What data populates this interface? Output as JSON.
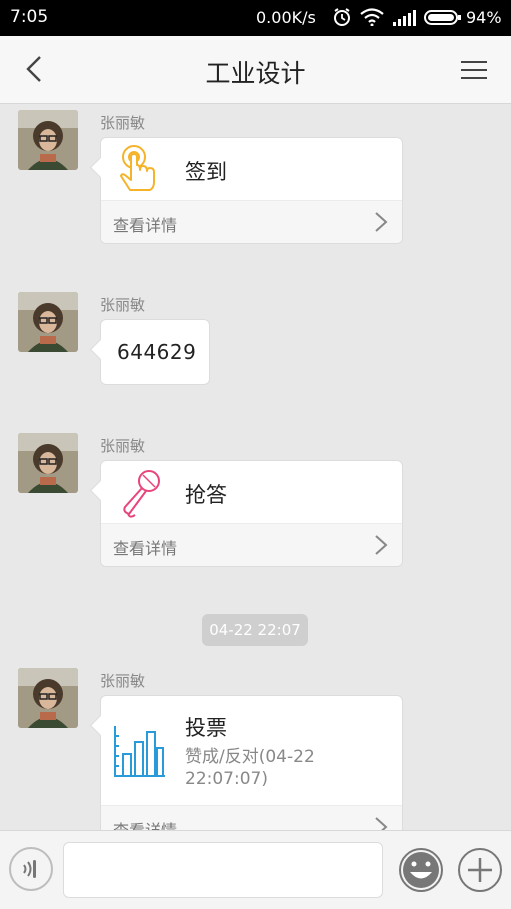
{
  "status_bar": {
    "time": "7:05",
    "network_speed": "0.00K/s",
    "battery_percent": "94%",
    "battery_level": 0.94
  },
  "header": {
    "title": "工业设计"
  },
  "messages": [
    {
      "sender": "张丽敏",
      "type": "card",
      "icon": "tap-hand-icon",
      "label": "签到",
      "more_label": "查看详情"
    },
    {
      "sender": "张丽敏",
      "type": "text",
      "text": "644629"
    },
    {
      "sender": "张丽敏",
      "type": "card",
      "icon": "microphone-icon",
      "label": "抢答",
      "more_label": "查看详情"
    },
    {
      "sender": "张丽敏",
      "type": "card",
      "icon": "bar-chart-icon",
      "label": "投票",
      "subtitle": "赞成/反对(04-22 22:07:07)",
      "more_label": "查看详情"
    }
  ],
  "timestamp": "04-22 22:07",
  "input": {
    "placeholder": ""
  },
  "colors": {
    "sign_in_icon": "#f5b32a",
    "quick_answer_icon": "#e8457a",
    "vote_icon": "#2a9bd9",
    "background": "#e8e8e8"
  }
}
